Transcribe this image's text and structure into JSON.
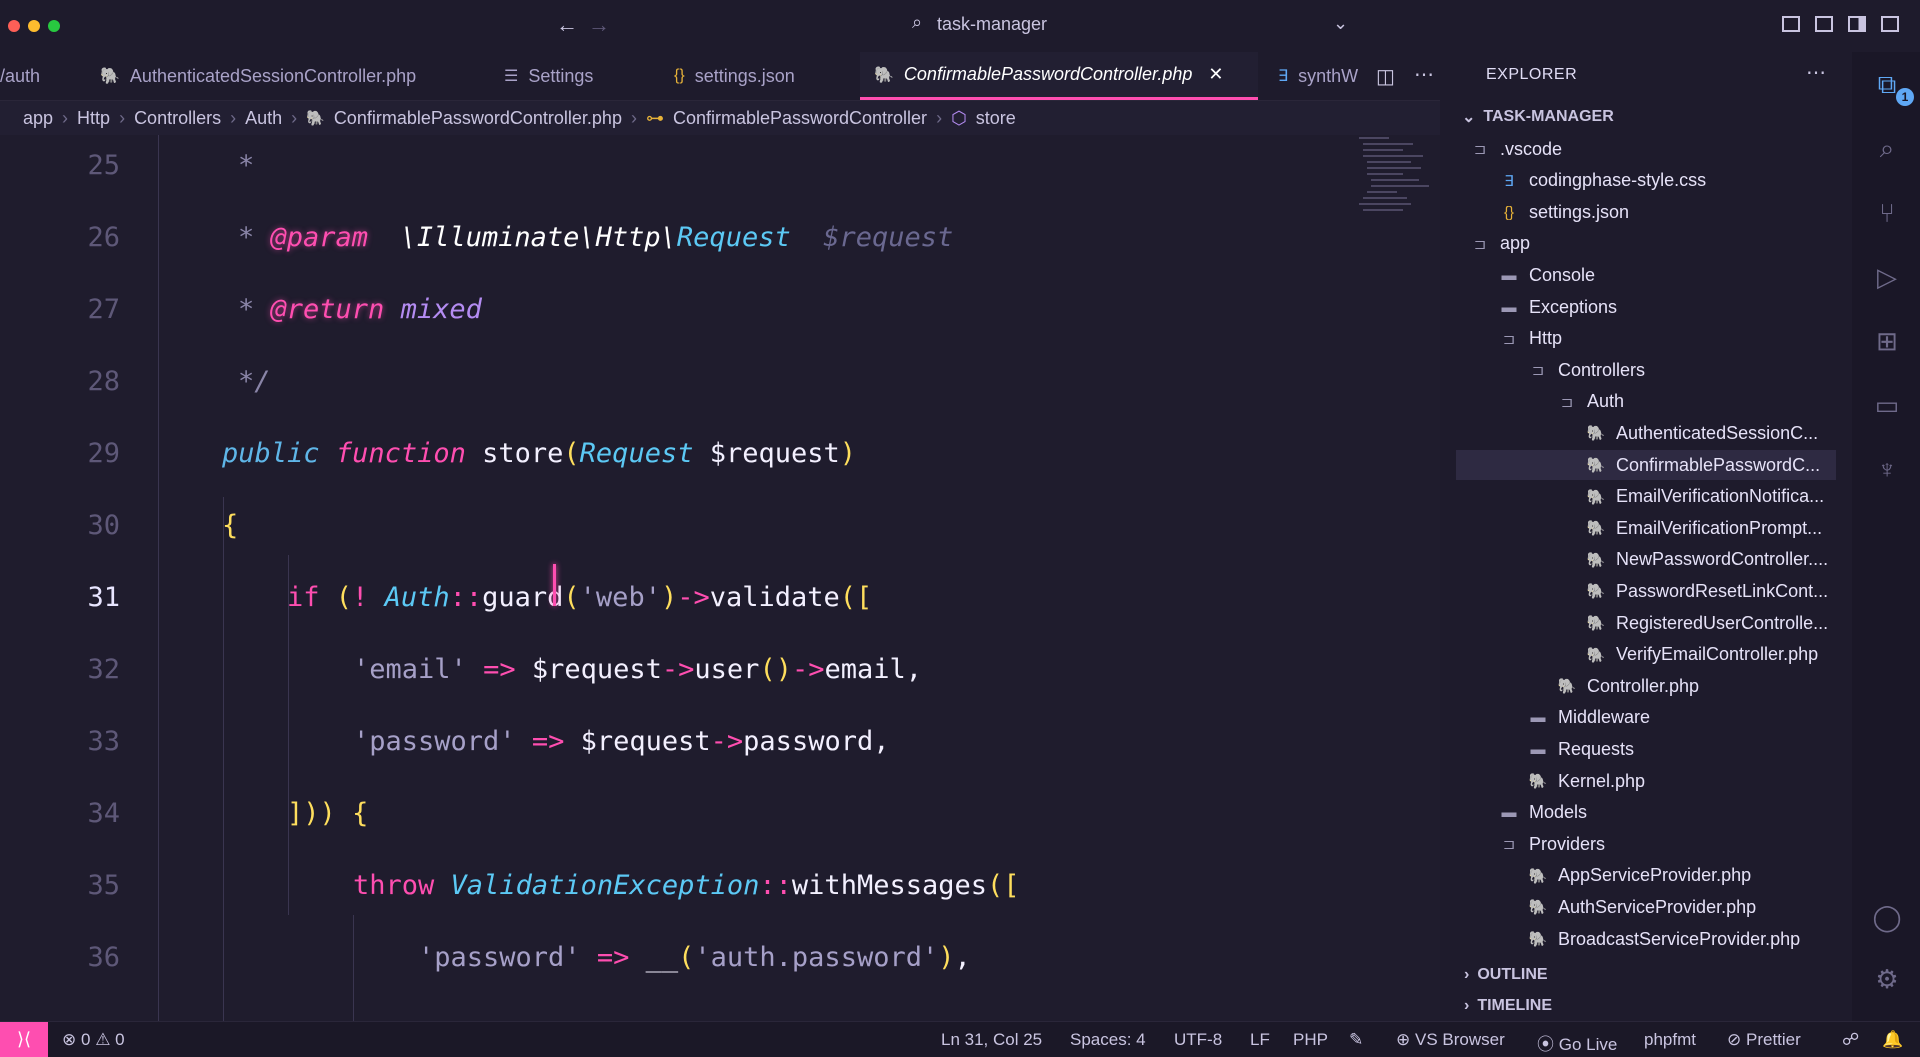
{
  "window": {
    "title": "task-manager"
  },
  "tabs": [
    {
      "label": "/auth",
      "icon": "path-fragment"
    },
    {
      "label": "AuthenticatedSessionController.php",
      "icon": "php-elephant-icon"
    },
    {
      "label": "Settings",
      "icon": "file-icon"
    },
    {
      "label": "settings.json",
      "icon": "json-braces-icon"
    },
    {
      "label": "ConfirmablePasswordController.php",
      "icon": "php-elephant-icon",
      "active": true
    },
    {
      "label": "synthW",
      "icon": "css-icon"
    }
  ],
  "breadcrumb": {
    "items": [
      "app",
      "Http",
      "Controllers",
      "Auth",
      "ConfirmablePasswordController.php",
      "ConfirmablePasswordController",
      "store"
    ]
  },
  "editor": {
    "current_line": "31",
    "lines": [
      {
        "n": "25",
        "t": "*"
      },
      {
        "n": "26",
        "t": "* @param  \\Illuminate\\Http\\Request  $request"
      },
      {
        "n": "27",
        "t": "* @return mixed"
      },
      {
        "n": "28",
        "t": "*/"
      },
      {
        "n": "29",
        "t": "public function store(Request $request)"
      },
      {
        "n": "30",
        "t": "{"
      },
      {
        "n": "31",
        "t": "if (! Auth::guard('web')->validate(["
      },
      {
        "n": "32",
        "t": "'email' => $request->user()->email,"
      },
      {
        "n": "33",
        "t": "'password' => $request->password,"
      },
      {
        "n": "34",
        "t": "])) {"
      },
      {
        "n": "35",
        "t": "throw ValidationException::withMessages(["
      },
      {
        "n": "36",
        "t": "'password' => __('auth.password'),"
      }
    ]
  },
  "explorer": {
    "title": "EXPLORER",
    "root": "TASK-MANAGER",
    "items": [
      {
        "label": ".vscode",
        "type": "folder-open"
      },
      {
        "label": "codingphase-style.css",
        "type": "css"
      },
      {
        "label": "settings.json",
        "type": "json"
      },
      {
        "label": "app",
        "type": "folder-open"
      },
      {
        "label": "Console",
        "type": "folder"
      },
      {
        "label": "Exceptions",
        "type": "folder"
      },
      {
        "label": "Http",
        "type": "folder-open"
      },
      {
        "label": "Controllers",
        "type": "folder-open"
      },
      {
        "label": "Auth",
        "type": "folder-open"
      },
      {
        "label": "AuthenticatedSessionC...",
        "type": "php"
      },
      {
        "label": "ConfirmablePasswordC...",
        "type": "php",
        "selected": true
      },
      {
        "label": "EmailVerificationNotifica...",
        "type": "php"
      },
      {
        "label": "EmailVerificationPrompt...",
        "type": "php"
      },
      {
        "label": "NewPasswordController....",
        "type": "php"
      },
      {
        "label": "PasswordResetLinkCont...",
        "type": "php"
      },
      {
        "label": "RegisteredUserControlle...",
        "type": "php"
      },
      {
        "label": "VerifyEmailController.php",
        "type": "php"
      },
      {
        "label": "Controller.php",
        "type": "php"
      },
      {
        "label": "Middleware",
        "type": "folder"
      },
      {
        "label": "Requests",
        "type": "folder"
      },
      {
        "label": "Kernel.php",
        "type": "php"
      },
      {
        "label": "Models",
        "type": "folder"
      },
      {
        "label": "Providers",
        "type": "folder-open"
      },
      {
        "label": "AppServiceProvider.php",
        "type": "php"
      },
      {
        "label": "AuthServiceProvider.php",
        "type": "php"
      },
      {
        "label": "BroadcastServiceProvider.php",
        "type": "php"
      }
    ],
    "sections": [
      "OUTLINE",
      "TIMELINE"
    ]
  },
  "activity": {
    "explorer_badge": "1"
  },
  "status": {
    "errors": "0",
    "warnings": "0",
    "position": "Ln 31, Col 25",
    "spaces": "Spaces: 4",
    "encoding": "UTF-8",
    "eol": "LF",
    "language": "PHP",
    "vs_browser": "VS Browser",
    "go_live": "Go Live",
    "phpfmt": "phpfmt",
    "prettier": "Prettier"
  },
  "colors": {
    "accent_pink": "#fe4eb0",
    "accent_cyan": "#36f9f6",
    "remote_button": "#fe4eb0"
  }
}
